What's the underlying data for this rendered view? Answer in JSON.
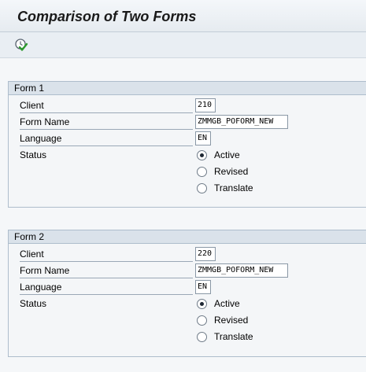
{
  "header": {
    "title": "Comparison of Two Forms"
  },
  "toolbar": {
    "execute_icon": "execute-clock-check-icon"
  },
  "labels": {
    "client": "Client",
    "form_name": "Form Name",
    "language": "Language",
    "status": "Status"
  },
  "status_options": [
    "Active",
    "Revised",
    "Translate"
  ],
  "form1": {
    "title": "Form 1",
    "client": "210",
    "form_name": "ZMMGB_POFORM_NEW",
    "language": "EN",
    "status": "Active"
  },
  "form2": {
    "title": "Form 2",
    "client": "220",
    "form_name": "ZMMGB_POFORM_NEW",
    "language": "EN",
    "status": "Active"
  }
}
